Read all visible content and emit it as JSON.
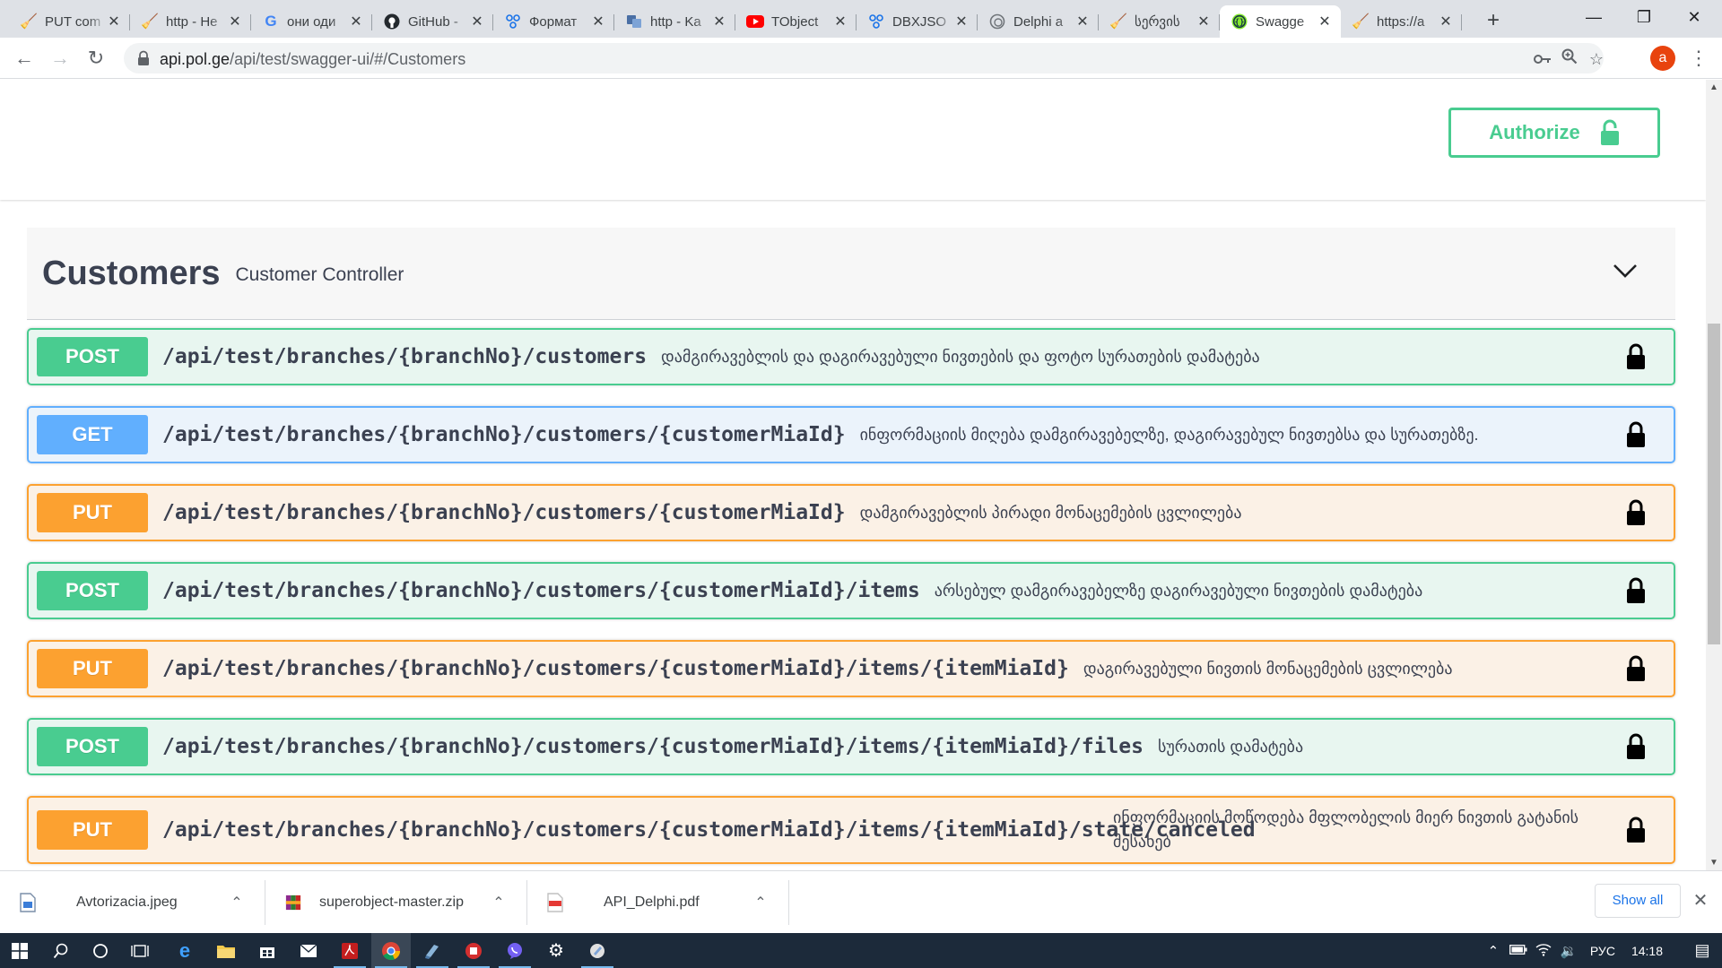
{
  "browser": {
    "tabs": [
      {
        "title": "PUT com",
        "icon": "broom-icon",
        "active": false
      },
      {
        "title": "http - He",
        "icon": "broom-icon",
        "active": false
      },
      {
        "title": "они оди",
        "icon": "google-icon",
        "active": false
      },
      {
        "title": "GitHub -",
        "icon": "github-icon",
        "active": false
      },
      {
        "title": "Формат",
        "icon": "dots-icon",
        "active": false
      },
      {
        "title": "http - Ka",
        "icon": "translate-icon",
        "active": false
      },
      {
        "title": "TObject",
        "icon": "youtube-icon",
        "active": false
      },
      {
        "title": "DBXJSO",
        "icon": "dots-icon",
        "active": false
      },
      {
        "title": "Delphi a",
        "icon": "chat-icon",
        "active": false
      },
      {
        "title": "სერვის",
        "icon": "broom-icon",
        "active": false
      },
      {
        "title": "Swagge",
        "icon": "swagger-icon",
        "active": true
      },
      {
        "title": "https://a",
        "icon": "broom-icon",
        "active": false
      }
    ],
    "new_tab_label": "+",
    "url_host": "api.pol.ge",
    "url_path": "/api/test/swagger-ui/#/Customers",
    "avatar_letter": "a"
  },
  "swagger": {
    "authorize_label": "Authorize",
    "tag": {
      "name": "Customers",
      "description": "Customer Controller"
    },
    "operations": [
      {
        "method": "POST",
        "path": "/api/test/branches/{branchNo}/customers",
        "summary": "დამგირავებლის და დაგირავებული ნივთების და ფოტო სურათების დამატება"
      },
      {
        "method": "GET",
        "path": "/api/test/branches/{branchNo}/customers/{customerMiaId}",
        "summary": "ინფორმაციის მიღება დამგირავებელზე, დაგირავებულ ნივთებსა და სურათებზე."
      },
      {
        "method": "PUT",
        "path": "/api/test/branches/{branchNo}/customers/{customerMiaId}",
        "summary": "დამგირავებლის პირადი მონაცემების ცვლილება"
      },
      {
        "method": "POST",
        "path": "/api/test/branches/{branchNo}/customers/{customerMiaId}/items",
        "summary": "არსებულ დამგირავებელზე დაგირავებული ნივთების დამატება"
      },
      {
        "method": "PUT",
        "path": "/api/test/branches/{branchNo}/customers/{customerMiaId}/items/{itemMiaId}",
        "summary": "დაგირავებული ნივთის მონაცემების ცვლილება"
      },
      {
        "method": "POST",
        "path": "/api/test/branches/{branchNo}/customers/{customerMiaId}/items/{itemMiaId}/files",
        "summary": "სურათის დამატება"
      },
      {
        "method": "PUT",
        "path": "/api/test/branches/{branchNo}/customers/{customerMiaId}/items/{itemMiaId}/state/canceled",
        "summary": "ინფორმაციის მოწოდება მფლობელის მიერ ნივთის გატანის შესახებ"
      }
    ]
  },
  "downloads": {
    "items": [
      {
        "name": "Avtorizacia.jpeg",
        "icon": "image-file-icon"
      },
      {
        "name": "superobject-master.zip",
        "icon": "archive-file-icon"
      },
      {
        "name": "API_Delphi.pdf",
        "icon": "pdf-file-icon"
      }
    ],
    "show_all_label": "Show all"
  },
  "taskbar": {
    "language": "РУС",
    "time": "14:18"
  },
  "colors": {
    "post": "#49cc90",
    "get": "#61affe",
    "put": "#fca130",
    "authorize": "#49cc90"
  }
}
